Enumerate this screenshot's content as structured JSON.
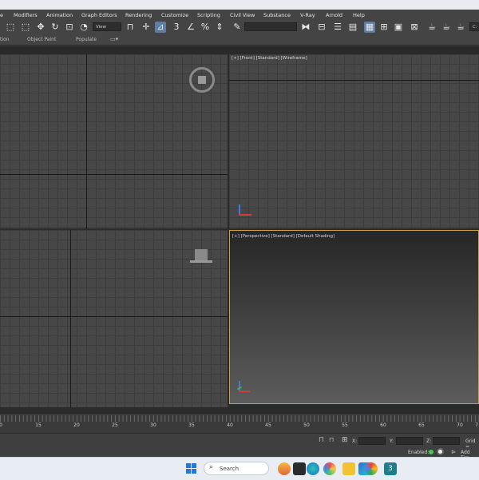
{
  "menu": [
    "e",
    "Modifiers",
    "Animation",
    "Graph Editors",
    "Rendering",
    "Customize",
    "Scripting",
    "Civil View",
    "Substance",
    "V-Ray",
    "Arnold",
    "Help"
  ],
  "toolbar": {
    "view_dropdown": "View",
    "numbers": [
      "3",
      "%"
    ],
    "right_stub": "C:"
  },
  "ribbon": {
    "tabs": [
      "tion",
      "Object Paint",
      "Populate"
    ]
  },
  "viewports": {
    "front_label": "[+] [Front] [Standard] [Wireframe]",
    "perspective_label": "[+] [Perspective] [Standard] [Default Shading]",
    "top_label": "",
    "left_label": ""
  },
  "timeline": {
    "ticks": [
      "0",
      "15",
      "20",
      "25",
      "30",
      "35",
      "40",
      "45",
      "50",
      "55",
      "60",
      "65",
      "70",
      "7"
    ]
  },
  "status": {
    "x_label": "X:",
    "y_label": "Y:",
    "z_label": "Z:",
    "grid_label": "Grid =",
    "enabled_label": "Enabled:",
    "add_time_label": "Add Tim"
  },
  "taskbar": {
    "search_placeholder": "Search"
  }
}
